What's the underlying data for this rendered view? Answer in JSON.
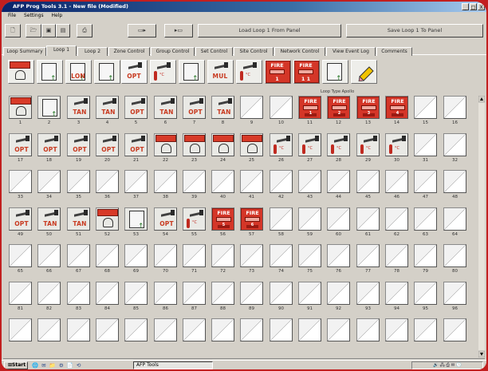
{
  "window": {
    "title": "AFP Prog Tools 3.1 - New file (Modified)",
    "controls": [
      "_",
      "□",
      "X"
    ]
  },
  "menu": [
    {
      "label": "File"
    },
    {
      "label": "Settings"
    },
    {
      "label": "Help"
    }
  ],
  "toolbar": {
    "buttons": [
      {
        "name": "new-file-button",
        "icon": "new-file-icon",
        "glyph": "🗋"
      },
      {
        "name": "open-file-button",
        "icon": "open-folder-icon",
        "glyph": "🗁"
      },
      {
        "name": "save-file-button",
        "icon": "save-disk-icon",
        "glyph": "▣"
      },
      {
        "name": "save-as-button",
        "icon": "save-as-icon",
        "glyph": "▤"
      },
      {
        "name": "print-button",
        "icon": "printer-icon",
        "glyph": "⎙"
      },
      {
        "name": "upload-to-panel-button",
        "icon": "upload-panel-icon",
        "glyph": "▭▸"
      },
      {
        "name": "download-from-panel-button",
        "icon": "download-panel-icon",
        "glyph": "▸▭"
      }
    ],
    "load_label": "Load Loop 1 From Panel",
    "save_label": "Save Loop 1 To Panel"
  },
  "tabs": [
    {
      "label": "Loop Summary"
    },
    {
      "label": "Loop 1"
    },
    {
      "label": "Loop 2"
    },
    {
      "label": "Zone Control"
    },
    {
      "label": "Group Control"
    },
    {
      "label": "Set Control"
    },
    {
      "label": "Site Control"
    },
    {
      "label": "Network Control"
    },
    {
      "label": "View Event Log"
    },
    {
      "label": "Comments"
    }
  ],
  "active_tab": "Loop 1",
  "palette": {
    "items": [
      {
        "type": "sounder"
      },
      {
        "type": "io"
      },
      {
        "type": "io",
        "code": "LON"
      },
      {
        "type": "io2"
      },
      {
        "type": "sensor",
        "code": "OPT"
      },
      {
        "type": "heat"
      },
      {
        "type": "io"
      },
      {
        "type": "multi",
        "code": "MUL"
      },
      {
        "type": "heat2"
      },
      {
        "type": "fire",
        "label": "FIRE",
        "sub": "1"
      },
      {
        "type": "fire",
        "label": "FIRE",
        "sub": "1 1"
      },
      {
        "type": "io"
      },
      {
        "type": "edit"
      }
    ],
    "grid_caption": "Loop Type Apollo"
  },
  "grid": {
    "fire_label": "FIRE",
    "heat_label": "°C",
    "rows": [
      {
        "numbers": [
          "1",
          "2",
          "3",
          "4",
          "5",
          "6",
          "7",
          "8",
          "9",
          "10",
          "11",
          "12",
          "13",
          "14",
          "15",
          "16"
        ],
        "cells": [
          {
            "type": "sounder"
          },
          {
            "type": "switch"
          },
          {
            "type": "sensor",
            "code": "TAN"
          },
          {
            "type": "sensor",
            "code": "TAN"
          },
          {
            "type": "sensor",
            "code": "OPT"
          },
          {
            "type": "sensor",
            "code": "TAN"
          },
          {
            "type": "sensor",
            "code": "OPT"
          },
          {
            "type": "sensor",
            "code": "TAN"
          },
          {
            "type": "empty"
          },
          {
            "type": "empty"
          },
          {
            "type": "fire",
            "sub": "1"
          },
          {
            "type": "fire",
            "sub": "2"
          },
          {
            "type": "fire",
            "sub": "3"
          },
          {
            "type": "fire",
            "sub": "4"
          },
          {
            "type": "empty"
          },
          {
            "type": "empty"
          }
        ]
      },
      {
        "numbers": [
          "17",
          "18",
          "19",
          "20",
          "21",
          "22",
          "23",
          "24",
          "25",
          "26",
          "27",
          "28",
          "29",
          "30",
          "31",
          "32"
        ],
        "cells": [
          {
            "type": "sensor",
            "code": "OPT"
          },
          {
            "type": "sensor",
            "code": "OPT"
          },
          {
            "type": "sensor",
            "code": "OPT"
          },
          {
            "type": "sensor",
            "code": "OPT"
          },
          {
            "type": "sensor",
            "code": "OPT"
          },
          {
            "type": "sounder"
          },
          {
            "type": "sounder"
          },
          {
            "type": "sounder"
          },
          {
            "type": "sounder"
          },
          {
            "type": "heat"
          },
          {
            "type": "heat"
          },
          {
            "type": "heat"
          },
          {
            "type": "heat"
          },
          {
            "type": "heat"
          },
          {
            "type": "empty"
          },
          {
            "type": "empty"
          }
        ]
      },
      {
        "numbers": [
          "33",
          "34",
          "35",
          "36",
          "37",
          "38",
          "39",
          "40",
          "41",
          "42",
          "43",
          "44",
          "45",
          "46",
          "47",
          "48"
        ],
        "cells": [
          {
            "type": "empty"
          },
          {
            "type": "empty"
          },
          {
            "type": "empty"
          },
          {
            "type": "empty"
          },
          {
            "type": "empty"
          },
          {
            "type": "empty"
          },
          {
            "type": "empty"
          },
          {
            "type": "empty"
          },
          {
            "type": "empty"
          },
          {
            "type": "empty"
          },
          {
            "type": "empty"
          },
          {
            "type": "empty"
          },
          {
            "type": "empty"
          },
          {
            "type": "empty"
          },
          {
            "type": "empty"
          },
          {
            "type": "empty"
          }
        ]
      },
      {
        "numbers": [
          "49",
          "50",
          "51",
          "52",
          "53",
          "54",
          "55",
          "56",
          "57",
          "58",
          "59",
          "60",
          "61",
          "62",
          "63",
          "64"
        ],
        "cells": [
          {
            "type": "sensor",
            "code": "OPT"
          },
          {
            "type": "sensor",
            "code": "TAN"
          },
          {
            "type": "sensor",
            "code": "TAN"
          },
          {
            "type": "sounder"
          },
          {
            "type": "switch"
          },
          {
            "type": "sensor",
            "code": "OPT"
          },
          {
            "type": "heat"
          },
          {
            "type": "fire",
            "sub": "5"
          },
          {
            "type": "fire",
            "sub": "6"
          },
          {
            "type": "empty"
          },
          {
            "type": "empty"
          },
          {
            "type": "empty"
          },
          {
            "type": "empty"
          },
          {
            "type": "empty"
          },
          {
            "type": "empty"
          },
          {
            "type": "empty"
          }
        ]
      },
      {
        "numbers": [
          "65",
          "66",
          "67",
          "68",
          "69",
          "70",
          "71",
          "72",
          "73",
          "74",
          "75",
          "76",
          "77",
          "78",
          "79",
          "80"
        ],
        "cells": [
          {
            "type": "empty"
          },
          {
            "type": "empty"
          },
          {
            "type": "empty"
          },
          {
            "type": "empty"
          },
          {
            "type": "empty"
          },
          {
            "type": "empty"
          },
          {
            "type": "empty"
          },
          {
            "type": "empty"
          },
          {
            "type": "empty"
          },
          {
            "type": "empty"
          },
          {
            "type": "empty"
          },
          {
            "type": "empty"
          },
          {
            "type": "empty"
          },
          {
            "type": "empty"
          },
          {
            "type": "empty"
          },
          {
            "type": "empty"
          }
        ]
      },
      {
        "numbers": [
          "81",
          "82",
          "83",
          "84",
          "85",
          "86",
          "87",
          "88",
          "89",
          "90",
          "91",
          "92",
          "93",
          "94",
          "95",
          "96"
        ],
        "cells": [
          {
            "type": "empty"
          },
          {
            "type": "empty"
          },
          {
            "type": "empty"
          },
          {
            "type": "empty"
          },
          {
            "type": "empty"
          },
          {
            "type": "empty"
          },
          {
            "type": "empty"
          },
          {
            "type": "empty"
          },
          {
            "type": "empty"
          },
          {
            "type": "empty"
          },
          {
            "type": "empty"
          },
          {
            "type": "empty"
          },
          {
            "type": "empty"
          },
          {
            "type": "empty"
          },
          {
            "type": "empty"
          },
          {
            "type": "empty"
          }
        ]
      },
      {
        "numbers": [],
        "cells": [
          {
            "type": "empty"
          },
          {
            "type": "empty"
          },
          {
            "type": "empty"
          },
          {
            "type": "empty"
          },
          {
            "type": "empty"
          },
          {
            "type": "empty"
          },
          {
            "type": "empty"
          },
          {
            "type": "empty"
          },
          {
            "type": "empty"
          },
          {
            "type": "empty"
          },
          {
            "type": "empty"
          },
          {
            "type": "empty"
          },
          {
            "type": "empty"
          },
          {
            "type": "empty"
          },
          {
            "type": "empty"
          },
          {
            "type": "empty"
          }
        ]
      }
    ]
  },
  "taskbar": {
    "start_label": "Start",
    "quick_launch": "🌐 ✉ 📁 ⚙ 📄 ⟲",
    "task_label": "AFP Tools",
    "tray_text": "🔊 🖧 ⎙ ✉ 🕒"
  },
  "colors": {
    "frame": "#c21f1f",
    "titlebar": "#0a246a",
    "fire_device": "#d43628",
    "code_text": "#c83a20",
    "window_face": "#d4d0c8"
  }
}
